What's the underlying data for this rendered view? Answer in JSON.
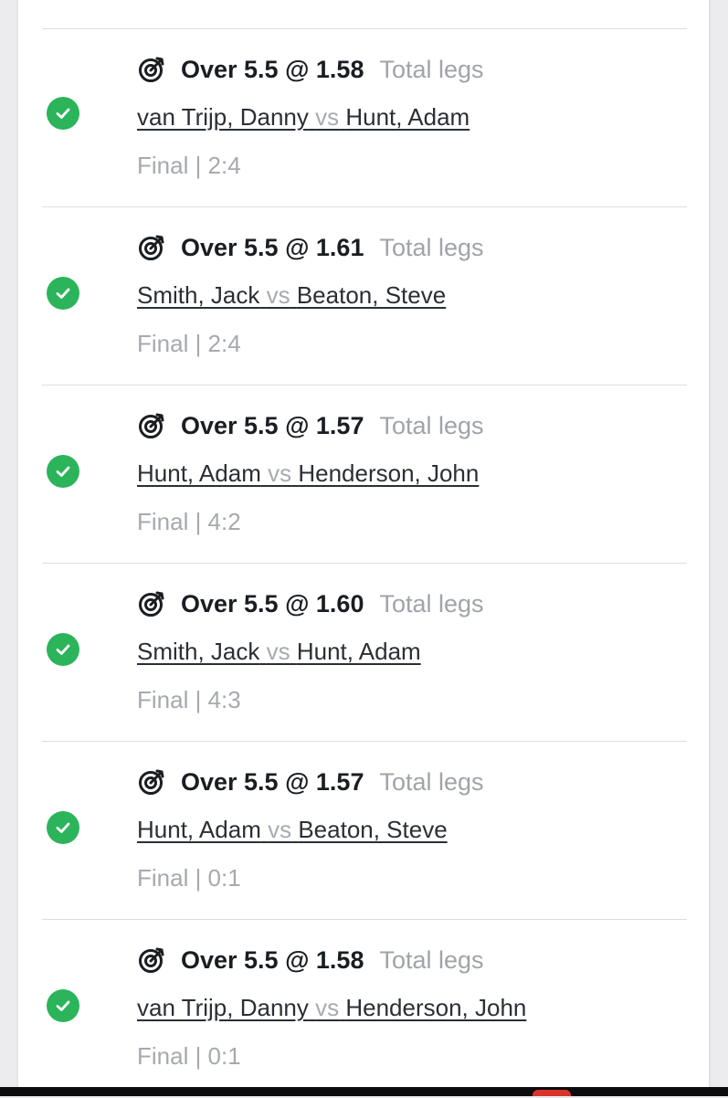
{
  "legs": [
    {
      "market": "Over 5.5 @ 1.58",
      "type": "Total legs",
      "player1": "van Trijp, Danny",
      "vs": "vs",
      "player2": "Hunt, Adam",
      "status": "Final | 2:4"
    },
    {
      "market": "Over 5.5 @ 1.61",
      "type": "Total legs",
      "player1": "Smith, Jack",
      "vs": "vs",
      "player2": "Beaton, Steve",
      "status": "Final | 2:4"
    },
    {
      "market": "Over 5.5 @ 1.57",
      "type": "Total legs",
      "player1": "Hunt, Adam",
      "vs": "vs",
      "player2": "Henderson, John",
      "status": "Final | 4:2"
    },
    {
      "market": "Over 5.5 @ 1.60",
      "type": "Total legs",
      "player1": "Smith, Jack",
      "vs": "vs",
      "player2": "Hunt, Adam",
      "status": "Final | 4:3"
    },
    {
      "market": "Over 5.5 @ 1.57",
      "type": "Total legs",
      "player1": "Hunt, Adam",
      "vs": "vs",
      "player2": "Beaton, Steve",
      "status": "Final | 0:1"
    },
    {
      "market": "Over 5.5 @ 1.58",
      "type": "Total legs",
      "player1": "van Trijp, Danny",
      "vs": "vs",
      "player2": "Henderson, John",
      "status": "Final | 0:1"
    }
  ],
  "icons": {
    "result": "check-circle-icon",
    "market": "target-icon"
  },
  "colors": {
    "win": "#2bb45a",
    "muted": "#a0a3a9",
    "text": "#1a1d21"
  }
}
